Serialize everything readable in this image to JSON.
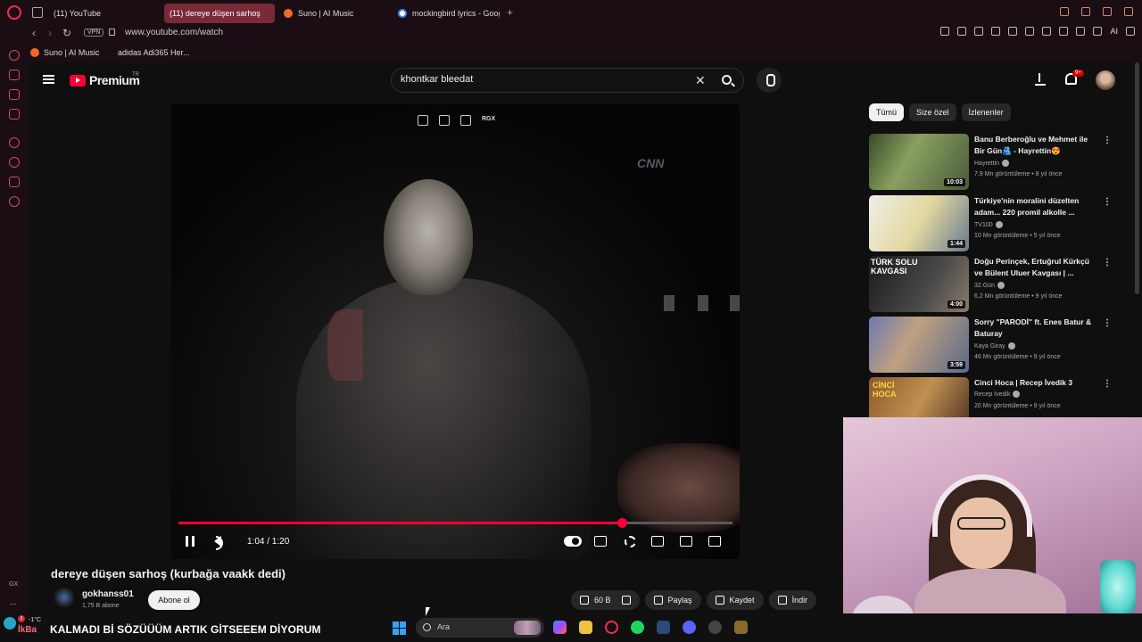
{
  "browser": {
    "tabs": [
      {
        "label": "(11) YouTube",
        "favicon": "youtube-icon"
      },
      {
        "label": "(11) dereye düşen sarhoş",
        "favicon": "youtube-icon",
        "active": true
      },
      {
        "label": "Suno | AI Music",
        "favicon": "suno-icon"
      },
      {
        "label": "mockingbird lyrics - Google",
        "favicon": "google-icon"
      }
    ],
    "vpn_label": "VPN",
    "url": "www.youtube.com/watch",
    "ai_label": "AI",
    "bookmarks": [
      {
        "label": "Suno | AI Music"
      },
      {
        "label": "adidas Adi365 Her..."
      }
    ],
    "sidebar_gx": "GX",
    "sidebar_more": "..."
  },
  "youtube": {
    "logo_text": "Premium",
    "logo_region": "TR",
    "search": {
      "value": "khontkar bleedat"
    },
    "notification_count": "9+",
    "player": {
      "watermark": "CNN",
      "rgx_label": "RGX",
      "time": "1:04 / 1:20",
      "progress": 0.8
    },
    "video_title": "dereye düşen sarhoş (kurbağa vaakk dedi)",
    "channel": {
      "name": "gokhanss01",
      "subscribers": "1,75 B abone"
    },
    "subscribe_label": "Abone ol",
    "actions": {
      "likes": "60 B",
      "share": "Paylaş",
      "save": "Kaydet",
      "download": "İndir"
    },
    "chips": [
      {
        "label": "Tümü",
        "selected": true
      },
      {
        "label": "Size özel",
        "selected": false
      },
      {
        "label": "İzlenenler",
        "selected": false
      }
    ],
    "recommendations": [
      {
        "title": "Banu Berberoğlu ve Mehmet ile Bir Gün🫂 - Hayrettin😍",
        "channel": "Hayrettin",
        "views": "7,9 Mn görüntüleme",
        "age": "8 yıl önce",
        "duration": "10:03"
      },
      {
        "title": "Türkiye'nin moralini düzelten adam... 220 promil alkolle ...",
        "channel": "TV100",
        "views": "10 Mn görüntüleme",
        "age": "5 yıl önce",
        "duration": "1:44"
      },
      {
        "title": "Doğu Perinçek, Ertuğrul Kürkçü ve Bülent Uluer Kavgası | ...",
        "channel": "32.Gün",
        "views": "6,2 Mn görüntüleme",
        "age": "9 yıl önce",
        "duration": "4:00",
        "thumb_text": "TÜRK SOLU KAVGASI"
      },
      {
        "title": "Sorry \"PARODİ\" ft. Enes Batur & Baturay",
        "channel": "Kaya Giray",
        "views": "46 Mn görüntüleme",
        "age": "9 yıl önce",
        "duration": "3:59"
      },
      {
        "title": "Cinci Hoca | Recep İvedik 3",
        "channel": "Recep İvedik",
        "views": "20 Mn görüntüleme",
        "age": "9 yıl önce",
        "duration": "",
        "thumb_text": "CİNCİ HOCA"
      }
    ]
  },
  "taskbar": {
    "weather_temp": "-1°C",
    "weather_badge": "3",
    "weather_label": "İkBa",
    "caption": "KALMADI Bİ SÖZÜÜÜM ARTIK GİTSEEEM DİYORUM",
    "search_placeholder": "Ara"
  },
  "colors": {
    "accent": "#ff0033",
    "browser_bg": "#1a0e14",
    "page_bg": "#0f0f0f"
  }
}
